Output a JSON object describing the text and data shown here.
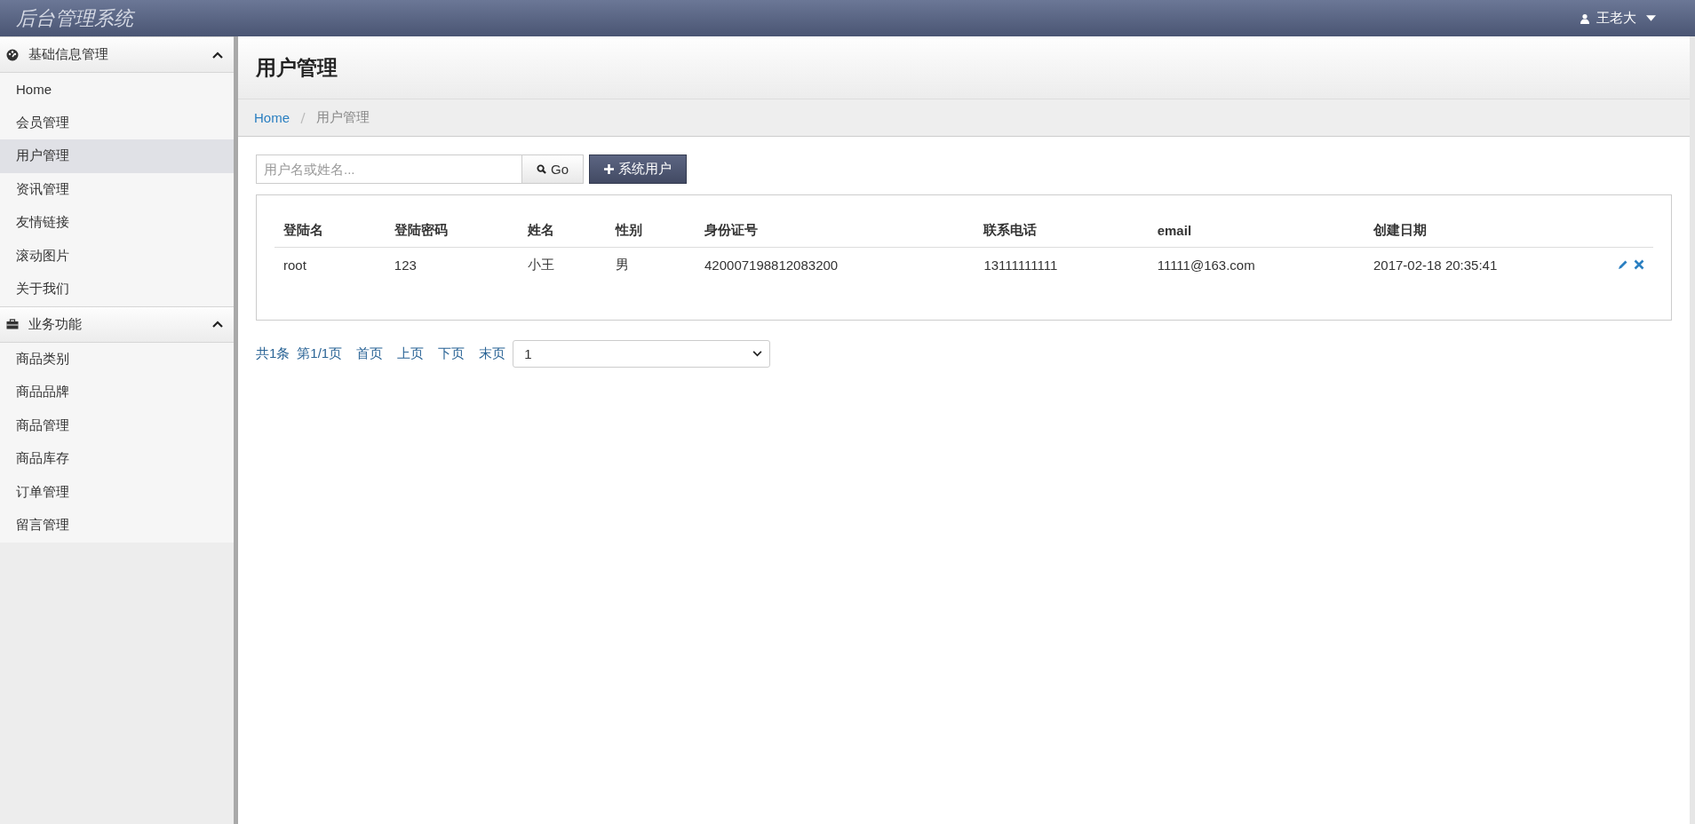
{
  "app_title": "后台管理系统",
  "user_menu": {
    "name": "王老大"
  },
  "sidebar": {
    "groups": [
      {
        "title": "基础信息管理",
        "expanded": true,
        "items": [
          {
            "label": "Home",
            "selected": false
          },
          {
            "label": "会员管理",
            "selected": false
          },
          {
            "label": "用户管理",
            "selected": true
          },
          {
            "label": "资讯管理",
            "selected": false
          },
          {
            "label": "友情链接",
            "selected": false
          },
          {
            "label": "滚动图片",
            "selected": false
          },
          {
            "label": "关于我们",
            "selected": false
          }
        ]
      },
      {
        "title": "业务功能",
        "expanded": true,
        "items": [
          {
            "label": "商品类别",
            "selected": false
          },
          {
            "label": "商品品牌",
            "selected": false
          },
          {
            "label": "商品管理",
            "selected": false
          },
          {
            "label": "商品库存",
            "selected": false
          },
          {
            "label": "订单管理",
            "selected": false
          },
          {
            "label": "留言管理",
            "selected": false
          }
        ]
      }
    ]
  },
  "page_title": "用户管理",
  "breadcrumb": [
    {
      "label": "Home",
      "link": true
    },
    {
      "label": "用户管理",
      "link": false
    }
  ],
  "search": {
    "placeholder": "用户名或姓名...",
    "button": "Go"
  },
  "add_button": "系统用户",
  "table": {
    "columns": [
      "登陆名",
      "登陆密码",
      "姓名",
      "性别",
      "身份证号",
      "联系电话",
      "email",
      "创建日期"
    ],
    "rows": [
      {
        "cells": [
          "root",
          "123",
          "小王",
          "男",
          "420007198812083200",
          "13111111111",
          "11111@163.com",
          "2017-02-18 20:35:41"
        ]
      }
    ]
  },
  "pagination": {
    "total": "共1条",
    "page": "第1/1页",
    "links": [
      "首页",
      "上页",
      "下页",
      "末页"
    ],
    "page_select": "1"
  }
}
